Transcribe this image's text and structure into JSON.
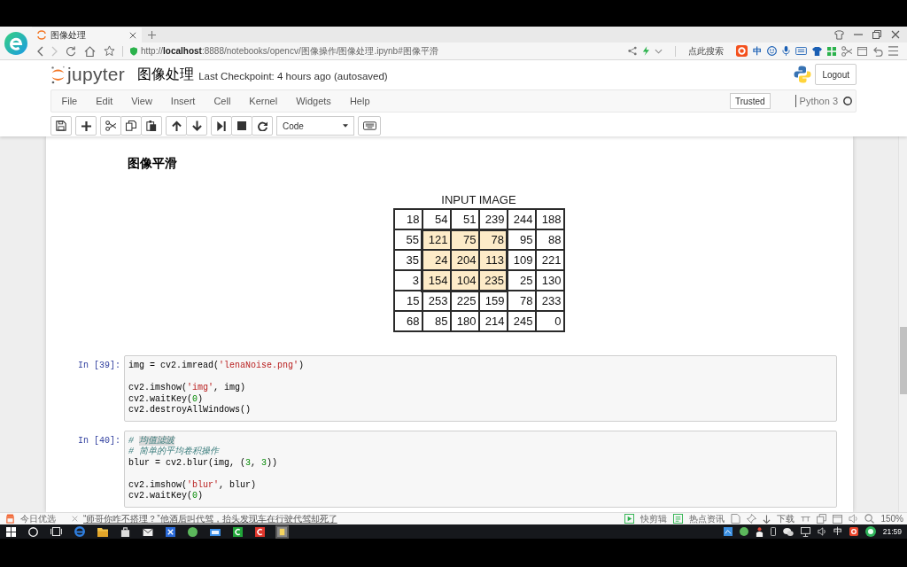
{
  "browser": {
    "tab_title": "图像处理",
    "forward_disabled": true,
    "url": "http://**localhost**:8888/notebooks/opencv/图像操作/图像处理.ipynb#图像平滑",
    "search_label": "点此搜索",
    "ime_label": "中"
  },
  "jupyter": {
    "logo_text": "jupyter",
    "title": "图像处理",
    "checkpoint": "Last Checkpoint: 4 hours ago (autosaved)",
    "logout": "Logout",
    "menu": [
      "File",
      "Edit",
      "View",
      "Insert",
      "Cell",
      "Kernel",
      "Widgets",
      "Help"
    ],
    "trusted": "Trusted",
    "kernel": "Python 3",
    "kernel_busy": false,
    "cell_type": "Code"
  },
  "notebook": {
    "cells": [
      {
        "kind": "markdown",
        "heading": "图像平滑",
        "figure": {
          "title": "INPUT IMAGE",
          "rows": [
            {
              "cells": [
                {
                  "text": "18",
                  "highlighted": false
                },
                {
                  "text": "54",
                  "highlighted": false
                },
                {
                  "text": "51",
                  "highlighted": false
                },
                {
                  "text": "239",
                  "highlighted": false
                },
                {
                  "text": "244",
                  "highlighted": false
                },
                {
                  "text": "188",
                  "highlighted": false
                }
              ]
            },
            {
              "cells": [
                {
                  "text": "55",
                  "highlighted": false
                },
                {
                  "text": "121",
                  "highlighted": true
                },
                {
                  "text": "75",
                  "highlighted": true
                },
                {
                  "text": "78",
                  "highlighted": true
                },
                {
                  "text": "95",
                  "highlighted": false
                },
                {
                  "text": "88",
                  "highlighted": false
                }
              ]
            },
            {
              "cells": [
                {
                  "text": "35",
                  "highlighted": false
                },
                {
                  "text": "24",
                  "highlighted": true
                },
                {
                  "text": "204",
                  "highlighted": true
                },
                {
                  "text": "113",
                  "highlighted": true
                },
                {
                  "text": "109",
                  "highlighted": false
                },
                {
                  "text": "221",
                  "highlighted": false
                }
              ]
            },
            {
              "cells": [
                {
                  "text": "3",
                  "highlighted": false
                },
                {
                  "text": "154",
                  "highlighted": true
                },
                {
                  "text": "104",
                  "highlighted": true
                },
                {
                  "text": "235",
                  "highlighted": true
                },
                {
                  "text": "25",
                  "highlighted": false
                },
                {
                  "text": "130",
                  "highlighted": false
                }
              ]
            },
            {
              "cells": [
                {
                  "text": "15",
                  "highlighted": false
                },
                {
                  "text": "253",
                  "highlighted": false
                },
                {
                  "text": "225",
                  "highlighted": false
                },
                {
                  "text": "159",
                  "highlighted": false
                },
                {
                  "text": "78",
                  "highlighted": false
                },
                {
                  "text": "233",
                  "highlighted": false
                }
              ]
            },
            {
              "cells": [
                {
                  "text": "68",
                  "highlighted": false
                },
                {
                  "text": "85",
                  "highlighted": false
                },
                {
                  "text": "180",
                  "highlighted": false
                },
                {
                  "text": "214",
                  "highlighted": false
                },
                {
                  "text": "245",
                  "highlighted": false
                },
                {
                  "text": "0",
                  "highlighted": false
                }
              ]
            }
          ]
        }
      },
      {
        "kind": "code",
        "prompt": "In [39]:",
        "lines": [
          {
            "kind": "code",
            "tokens": [
              {
                "kind": "plain",
                "text": "img = cv2.imread("
              },
              {
                "kind": "string",
                "text": "'lenaNoise.png'"
              },
              {
                "kind": "plain",
                "text": ")"
              }
            ]
          },
          {
            "kind": "blank"
          },
          {
            "kind": "code",
            "tokens": [
              {
                "kind": "plain",
                "text": "cv2.imshow("
              },
              {
                "kind": "string",
                "text": "'img'"
              },
              {
                "kind": "plain",
                "text": ", img)"
              }
            ]
          },
          {
            "kind": "code",
            "tokens": [
              {
                "kind": "plain",
                "text": "cv2.waitKey("
              },
              {
                "kind": "number",
                "text": "0"
              },
              {
                "kind": "plain",
                "text": ")"
              }
            ]
          },
          {
            "kind": "code",
            "tokens": [
              {
                "kind": "plain",
                "text": "cv2.destroyAllWindows()"
              }
            ]
          }
        ]
      },
      {
        "kind": "code",
        "prompt": "In [40]:",
        "lines": [
          {
            "kind": "code",
            "tokens": [
              {
                "kind": "comment",
                "text": "# "
              },
              {
                "kind": "selection",
                "text": "均值滤波"
              }
            ]
          },
          {
            "kind": "code",
            "tokens": [
              {
                "kind": "comment",
                "text": "# 简单的平均卷积操作"
              }
            ]
          },
          {
            "kind": "code",
            "tokens": [
              {
                "kind": "plain",
                "text": "blur = cv2.blur(img, ("
              },
              {
                "kind": "number",
                "text": "3"
              },
              {
                "kind": "plain",
                "text": ", "
              },
              {
                "kind": "number",
                "text": "3"
              },
              {
                "kind": "plain",
                "text": "))"
              }
            ]
          },
          {
            "kind": "blank"
          },
          {
            "kind": "code",
            "tokens": [
              {
                "kind": "plain",
                "text": "cv2.imshow("
              },
              {
                "kind": "string",
                "text": "'blur'"
              },
              {
                "kind": "plain",
                "text": ", blur)"
              }
            ]
          },
          {
            "kind": "code",
            "tokens": [
              {
                "kind": "plain",
                "text": "cv2.waitKey("
              },
              {
                "kind": "number",
                "text": "0"
              },
              {
                "kind": "plain",
                "text": ")"
              }
            ]
          }
        ]
      }
    ]
  },
  "status_bar": {
    "channel": "今日优选",
    "headline": "“师哥你咋不搭理？”他酒后叫代驾，抬头发现车在行驶代驾却死了",
    "video_tool": "快剪辑",
    "news": "热点资讯",
    "download": "下载",
    "zoom": "150%"
  },
  "taskbar": {
    "ime_label": "中",
    "time": "21:59"
  }
}
